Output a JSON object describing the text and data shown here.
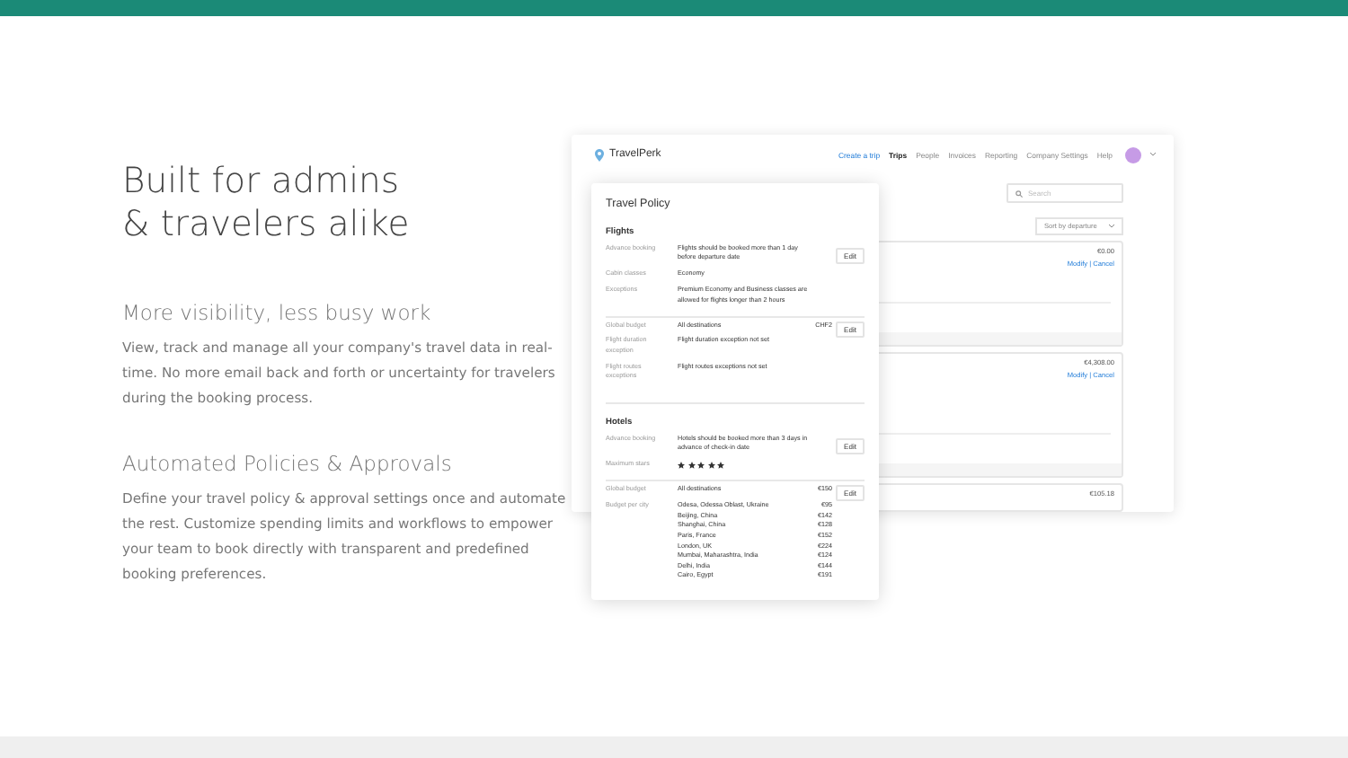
{
  "intro": {
    "title_lines": [
      "Built for admins",
      "& travelers alike"
    ],
    "features": [
      {
        "heading": "More visibility, less busy work",
        "text": "View, track and manage all your company's travel data in real-time. No more email back and forth or uncertainty for travelers during the booking process."
      },
      {
        "heading": "Automated Policies & Approvals",
        "text": "Define your travel policy & approval settings once and automate the rest. Customize spending limits and workflows to empower your team to book directly with transparent and predefined booking preferences."
      }
    ]
  },
  "app": {
    "logo": "TravelPerk",
    "nav": [
      {
        "label": "Create a trip",
        "kind": "primary",
        "selected": false
      },
      {
        "label": "Trips",
        "kind": "link",
        "selected": true
      },
      {
        "label": "People",
        "kind": "link",
        "selected": false
      },
      {
        "label": "Invoices",
        "kind": "link",
        "selected": false
      },
      {
        "label": "Reporting",
        "kind": "link",
        "selected": false
      },
      {
        "label": "Company Settings",
        "kind": "link",
        "selected": false
      },
      {
        "label": "Help",
        "kind": "link",
        "selected": false
      }
    ],
    "search": {
      "placeholder": "Search"
    },
    "sort": {
      "value": "Sort by departure"
    },
    "trips": [
      {
        "price": "€0.00",
        "actions": "Modify | Cancel"
      },
      {
        "price": "€4,308.00",
        "actions": "Modify | Cancel"
      },
      {
        "price": "€105.18"
      }
    ]
  },
  "policy": {
    "title": "Travel Policy",
    "sections": [
      {
        "title": "Flights",
        "groups": [
          {
            "edit": "Edit",
            "rows": [
              {
                "kind": "text",
                "label": "Advance booking",
                "value": "Flights should be booked more than 1 day before departure date"
              },
              {
                "kind": "text",
                "label": "Cabin classes",
                "value": "Economy"
              },
              {
                "kind": "text",
                "label": "Exceptions",
                "value": "Premium Economy and Business classes are allowed for flights longer than 2 hours"
              }
            ]
          },
          {
            "edit": "Edit",
            "rows": [
              {
                "kind": "text",
                "label": "Global budget",
                "value": "All destinations",
                "amount": "CHF2"
              },
              {
                "kind": "text",
                "label": "Flight duration exception",
                "value": "Flight duration exception not set"
              },
              {
                "kind": "text",
                "label": "Flight routes exceptions",
                "value": "Flight routes exceptions not set"
              }
            ]
          }
        ]
      },
      {
        "title": "Hotels",
        "groups": [
          {
            "edit": "Edit",
            "rows": [
              {
                "kind": "text",
                "label": "Advance booking",
                "value": "Hotels should be booked more than 3 days in advance of check-in date"
              },
              {
                "kind": "stars",
                "label": "Maximum stars",
                "stars": 5
              }
            ]
          },
          {
            "edit": "Edit",
            "rows": [
              {
                "kind": "text",
                "label": "Global budget",
                "value": "All destinations",
                "amount": "€150"
              },
              {
                "kind": "list",
                "label": "Budget per city",
                "items": [
                  {
                    "city": "Odesa, Odessa Oblast, Ukraine",
                    "amount": "€95"
                  },
                  {
                    "city": "Beijing, China",
                    "amount": "€142"
                  },
                  {
                    "city": "Shanghai, China",
                    "amount": "€128"
                  },
                  {
                    "city": "Paris, France",
                    "amount": "€152"
                  },
                  {
                    "city": "London, UK",
                    "amount": "€224"
                  },
                  {
                    "city": "Mumbai, Maharashtra, India",
                    "amount": "€124"
                  },
                  {
                    "city": "Delhi, India",
                    "amount": "€144"
                  },
                  {
                    "city": "Cairo, Egypt",
                    "amount": "€191"
                  }
                ]
              }
            ]
          }
        ]
      }
    ]
  }
}
